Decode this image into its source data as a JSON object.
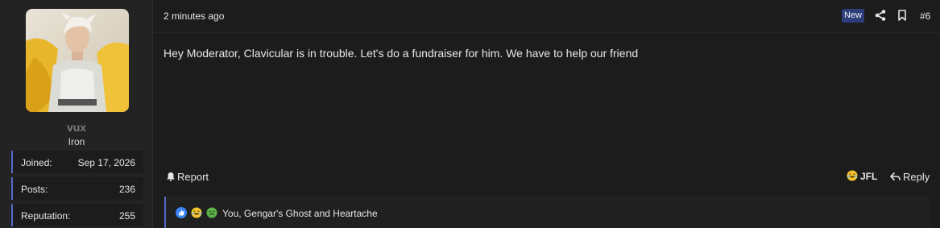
{
  "user": {
    "name": "vux",
    "rank": "Iron",
    "stats": [
      {
        "label": "Joined:",
        "value": "Sep 17, 2026"
      },
      {
        "label": "Posts:",
        "value": "236"
      },
      {
        "label": "Reputation:",
        "value": "255"
      }
    ]
  },
  "post": {
    "time": "2 minutes ago",
    "badge": "New",
    "number": "#6",
    "message": "Hey Moderator, Clavicular is in trouble. Let's do a fundraiser for him. We have to help our friend",
    "share_icon": "share-icon",
    "bookmark_icon": "bookmark-icon"
  },
  "actions": {
    "report": "Report",
    "reaction": "JFL",
    "reply": "Reply"
  },
  "reactions": {
    "icons": [
      "like-icon",
      "laugh-icon",
      "sick-icon"
    ],
    "text": "You, Gengar's Ghost and Heartache"
  },
  "colors": {
    "accent": "#5868c8",
    "badge_bg": "#2b3d7a",
    "background": "#1c1c1c",
    "panel": "#232323"
  }
}
